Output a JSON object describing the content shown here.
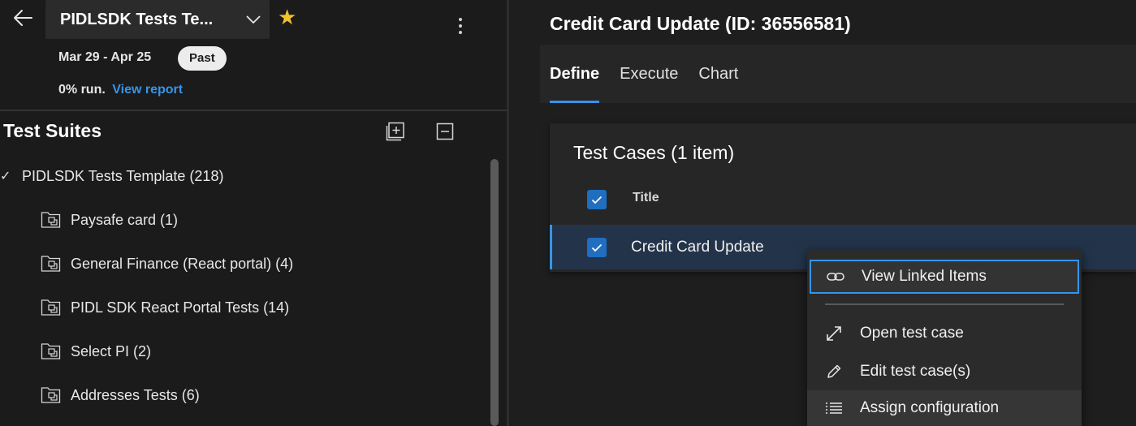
{
  "left_panel": {
    "plan_name": "PIDLSDK Tests Te...",
    "date_range": "Mar 29 - Apr 25",
    "status_badge": "Past",
    "run_summary": "0% run.",
    "view_report_link": "View report",
    "suites_heading": "Test Suites",
    "root_suite": "PIDLSDK Tests Template (218)",
    "suites": [
      {
        "label": "Paysafe card (1)"
      },
      {
        "label": "General Finance (React portal) (4)"
      },
      {
        "label": "PIDL SDK React Portal Tests (14)"
      },
      {
        "label": "Select PI (2)"
      },
      {
        "label": "Addresses Tests (6)"
      }
    ]
  },
  "right_panel": {
    "suite_title": "Credit Card Update (ID: 36556581)",
    "tabs": [
      {
        "label": "Define",
        "active": true
      },
      {
        "label": "Execute",
        "active": false
      },
      {
        "label": "Chart",
        "active": false
      }
    ],
    "cases_heading": "Test Cases (1 item)",
    "column_title": "Title",
    "rows": [
      {
        "title": "Credit Card Update",
        "selected": true
      }
    ]
  },
  "context_menu": {
    "items": [
      {
        "label": "View Linked Items",
        "icon": "link-icon"
      },
      {
        "label": "Open test case",
        "icon": "expand-diagonal-icon"
      },
      {
        "label": "Edit test case(s)",
        "icon": "pencil-icon"
      },
      {
        "label": "Assign configuration",
        "icon": "list-settings-icon"
      }
    ]
  },
  "colors": {
    "accent": "#3794e8",
    "star": "#f2c12e",
    "checkbox": "#1f6ec0",
    "selected_row": "#23344a",
    "panel_bg": "#1b1b1b"
  }
}
